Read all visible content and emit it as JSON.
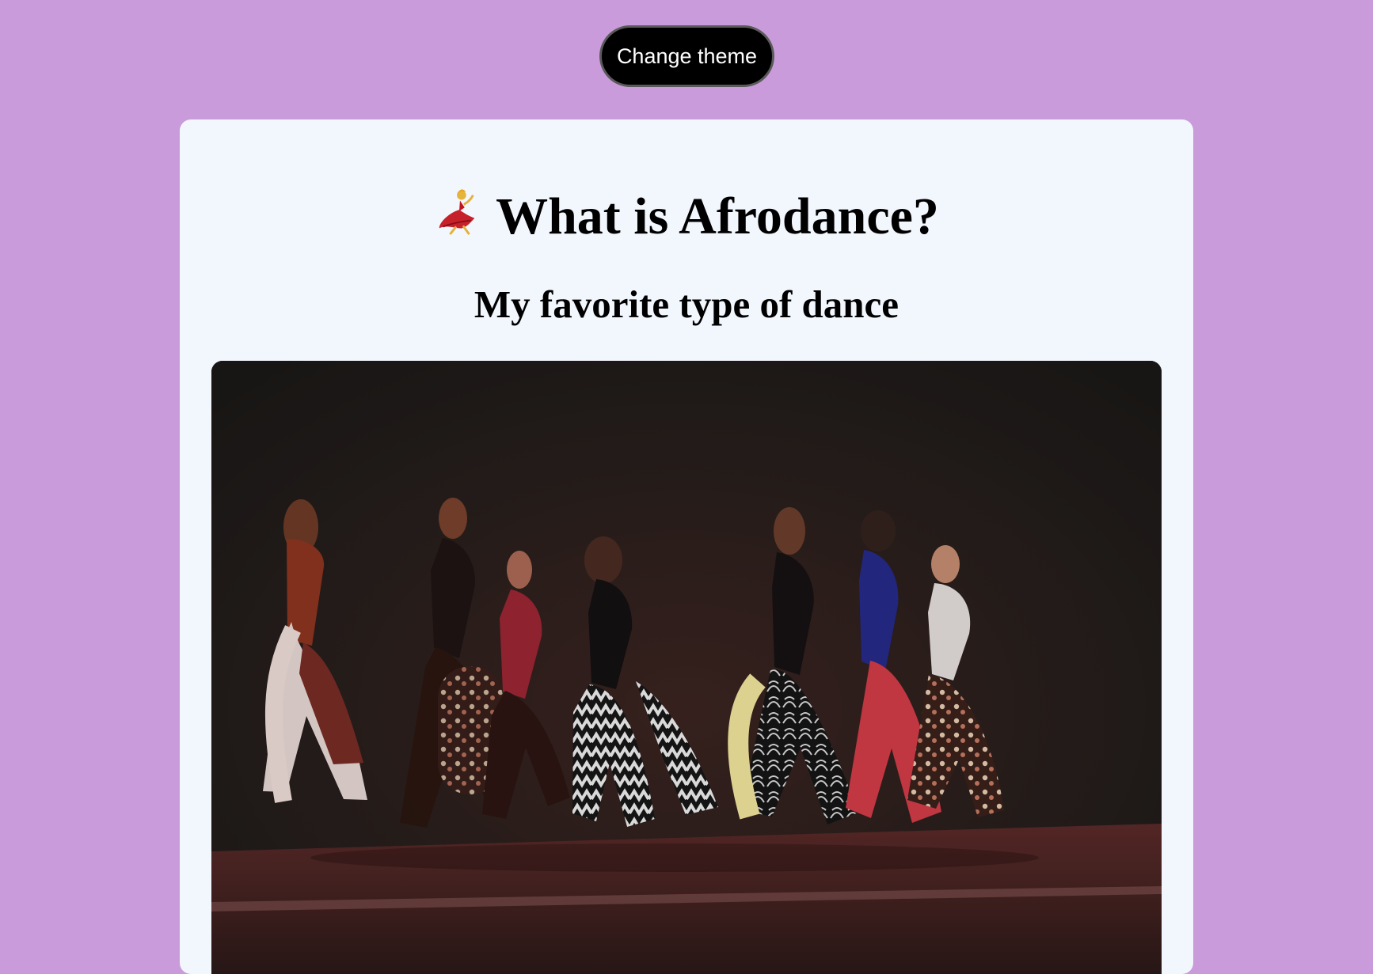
{
  "header": {
    "theme_button_label": "Change theme"
  },
  "card": {
    "title_emoji": "💃",
    "title": "What is Afrodance?",
    "subtitle": "My favorite type of dance",
    "image_description_icon": "dancers-photo"
  },
  "colors": {
    "page_background": "#c99bdb",
    "card_background": "#f2f6fd",
    "button_background": "#000000",
    "button_text": "#ffffff",
    "text": "#000000"
  }
}
